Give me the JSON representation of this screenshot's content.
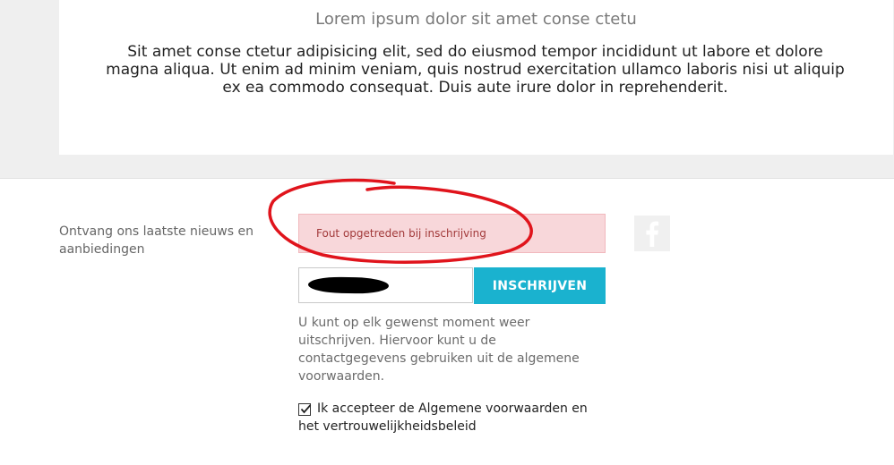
{
  "content": {
    "subtitle": "Lorem ipsum dolor sit amet conse ctetu",
    "body": "Sit amet conse ctetur adipisicing elit, sed do eiusmod tempor incididunt ut labore et dolore magna aliqua. Ut enim ad minim veniam, quis nostrud exercitation ullamco laboris nisi ut aliquip ex ea commodo consequat. Duis aute irure dolor in reprehenderit."
  },
  "newsletter": {
    "label": "Ontvang ons laatste nieuws en aanbiedingen",
    "error_message": "Fout opgetreden bij inschrijving",
    "email_value": "",
    "subscribe_label": "INSCHRIJVEN",
    "unsubscribe_info": "U kunt op elk gewenst moment weer uitschrijven. Hiervoor kunt u de contactgegevens gebruiken uit de algemene voorwaarden.",
    "terms_label": "Ik accepteer de Algemene voorwaarden en het vertrouwelijkheidsbeleid",
    "terms_checked": true
  },
  "social": {
    "facebook_icon": "facebook-icon"
  },
  "colors": {
    "accent": "#1ab2cf",
    "error_bg": "#f8d7da",
    "error_text": "#a23a3a",
    "annotation_red": "#e0141c"
  }
}
